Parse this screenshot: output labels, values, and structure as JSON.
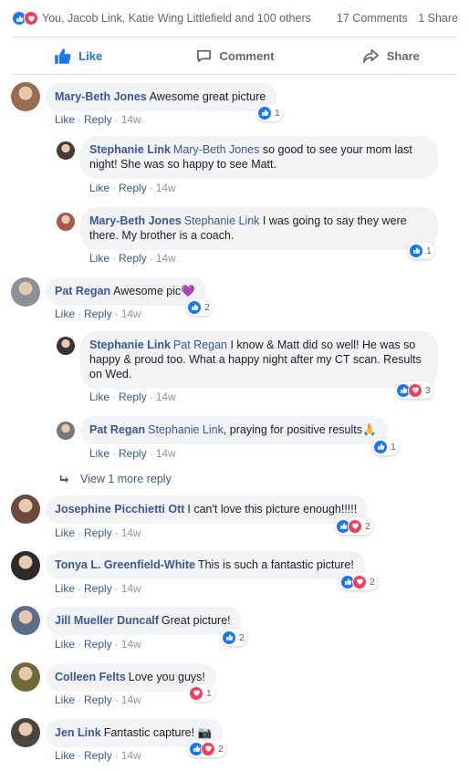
{
  "summary": {
    "names": "You, Jacob Link, Katie Wing Littlefield and 100 others",
    "comments": "17 Comments",
    "shares": "1 Share"
  },
  "actions": {
    "like": "Like",
    "comment": "Comment",
    "share": "Share"
  },
  "labels": {
    "like": "Like",
    "reply": "Reply",
    "view_more": "View 1 more reply"
  },
  "colors": {
    "like_blue": "#1877f2",
    "love_red": "#f33e58",
    "name_blue": "#385898"
  },
  "comments": [
    {
      "author": "Mary-Beth Jones",
      "mention": "",
      "text": "Awesome great picture",
      "time": "14w",
      "reactions": [
        "like"
      ],
      "count": "1"
    },
    {
      "author": "Stephanie Link",
      "mention": "Mary-Beth Jones",
      "text": "so good to see your mom last night! She was so happy to see Matt.",
      "time": "14w",
      "reactions": [],
      "count": ""
    },
    {
      "author": "Mary-Beth Jones",
      "mention": "Stephanie Link",
      "text": "I was going to say they were there. My brother is a coach.",
      "time": "14w",
      "reactions": [
        "like"
      ],
      "count": "1"
    },
    {
      "author": "Pat Regan",
      "mention": "",
      "text": "Awesome pic💜",
      "time": "14w",
      "reactions": [
        "like"
      ],
      "count": "2"
    },
    {
      "author": "Stephanie Link",
      "mention": "Pat Regan",
      "text": "I know & Matt did so well! He was so happy & proud too. What a happy night after my CT scan. Results on Wed.",
      "time": "14w",
      "reactions": [
        "like",
        "love"
      ],
      "count": "3"
    },
    {
      "author": "Pat Regan",
      "mention": "Stephanie Link",
      "text": ", praying for positive results🙏",
      "time": "14w",
      "reactions": [
        "like"
      ],
      "count": "1"
    },
    {
      "author": "Josephine Picchietti Ott",
      "mention": "",
      "text": "I can't love this picture enough!!!!!",
      "time": "14w",
      "reactions": [
        "like",
        "love"
      ],
      "count": "2"
    },
    {
      "author": "Tonya L. Greenfield-White",
      "mention": "",
      "text": "This is such a fantastic picture!",
      "time": "14w",
      "reactions": [
        "like",
        "love"
      ],
      "count": "2"
    },
    {
      "author": "Jill Mueller Duncalf",
      "mention": "",
      "text": "Great picture!",
      "time": "14w",
      "reactions": [
        "like"
      ],
      "count": "2"
    },
    {
      "author": "Colleen Felts",
      "mention": "",
      "text": "Love you guys!",
      "time": "14w",
      "reactions": [
        "love"
      ],
      "count": "1"
    },
    {
      "author": "Jen Link",
      "mention": "",
      "text": "Fantastic capture! 📷",
      "time": "14w",
      "reactions": [
        "like",
        "love"
      ],
      "count": "2"
    }
  ]
}
